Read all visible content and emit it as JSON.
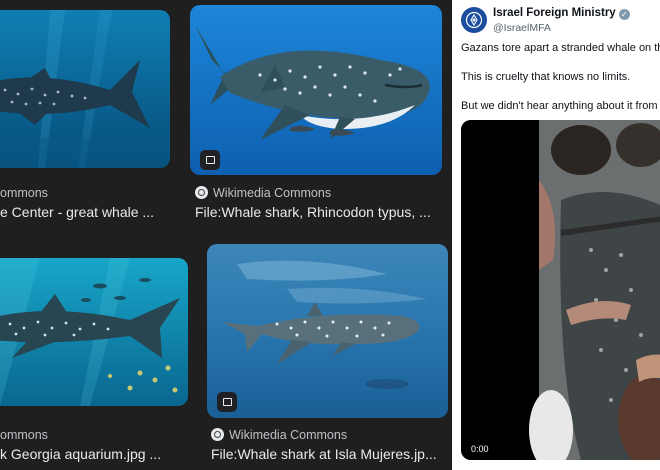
{
  "results": [
    {
      "source": "ommons",
      "title": "e Center - great whale ...",
      "badge_icon": "image-icon",
      "has_badge": false
    },
    {
      "source": "Wikimedia Commons",
      "title": "File:Whale shark, Rhincodon typus, ...",
      "badge_icon": "image-icon",
      "has_badge": true
    },
    {
      "source": "ommons",
      "title": "k Georgia aquarium.jpg ...",
      "badge_icon": "image-icon",
      "has_badge": false
    },
    {
      "source": "Wikimedia Commons",
      "title": "File:Whale shark at Isla Mujeres.jp...",
      "badge_icon": "image-icon",
      "has_badge": true
    }
  ],
  "tweet": {
    "account_name": "Israel Foreign Ministry",
    "verified_icon": "verified-badge-icon",
    "handle": "@IsraelMFA",
    "lines": [
      "Gazans tore apart a stranded whale on the",
      "This is cruelty that knows no limits.",
      "But we didn't hear anything about it from G"
    ],
    "video_time": "0:00"
  },
  "colors": {
    "page_bg": "#1f1f1f",
    "title_text": "#e8eaed",
    "source_text": "#bdc1c6",
    "tweet_bg": "#ffffff",
    "ministry_blue": "#1d4e9e"
  }
}
